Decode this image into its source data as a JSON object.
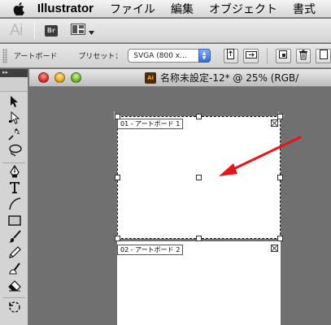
{
  "menubar": {
    "app_name": "Illustrator",
    "items": [
      "ファイル",
      "編集",
      "オブジェクト",
      "書式"
    ]
  },
  "appbar": {
    "logo_text": "Ai",
    "bridge_label": "Br"
  },
  "controlbar": {
    "artboard_label": "アートボード",
    "preset_label": "プリセット：",
    "preset_value": "SVGA (800 x..."
  },
  "tools_panel": {
    "collapse_glyph": "▸▸"
  },
  "document": {
    "title": "名称未設定-12* @ 25% (RGB/"
  },
  "artboards": [
    {
      "label": "01 - アートボード 1",
      "selected": true
    },
    {
      "label": "02 - アートボード 2",
      "selected": false
    }
  ],
  "colors": {
    "pasteboard": "#707070",
    "annotation_arrow": "#e8141a"
  }
}
